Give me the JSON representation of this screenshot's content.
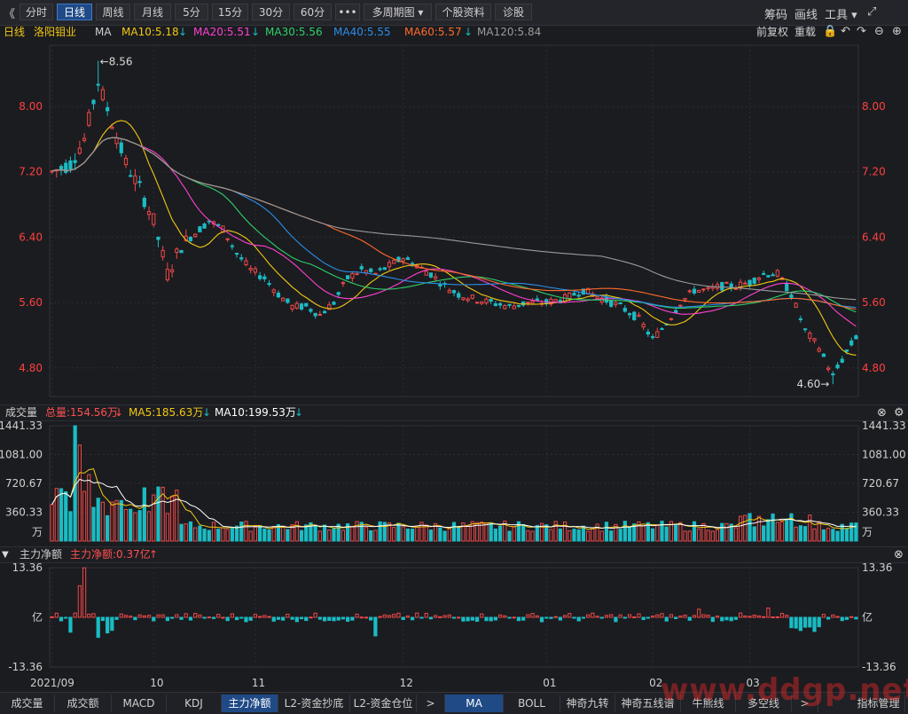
{
  "toolbar": {
    "back": "《",
    "tabs": [
      "分时",
      "日线",
      "周线",
      "月线",
      "5分",
      "15分",
      "30分",
      "60分",
      "•••",
      "多周期图 ▾",
      "个股资料",
      "诊股"
    ],
    "active_tab": 1,
    "right": [
      "筹码",
      "画线",
      "工具 ▾",
      "⤢"
    ]
  },
  "info": {
    "period": "日线",
    "stock": "洛阳钼业",
    "ma_label": "MA",
    "ma10": "MA10:5.18",
    "ma20": "MA20:5.51",
    "ma30": "MA30:5.56",
    "ma40": "MA40:5.55",
    "ma60": "MA60:5.57",
    "ma120": "MA120:5.84",
    "fq": "前复权",
    "reload": "重载"
  },
  "colors": {
    "up": "#f04848",
    "down": "#1bbcc4",
    "grid": "#2c2d33",
    "axis": "#ff4040",
    "ma5": "#ffffff",
    "ma10": "#f2c811",
    "ma20": "#ff40d0",
    "ma30": "#2ed06a",
    "ma40": "#2a8ee8",
    "ma60": "#ff6a2a",
    "ma120": "#9a9a9a"
  },
  "volume_bar": {
    "title": "成交量",
    "total": "总量:154.56万",
    "ma5": "MA5:185.63万",
    "ma10": "MA10:199.53万"
  },
  "flow_bar": {
    "title": "主力净额",
    "value": "主力净额:0.37亿"
  },
  "bottom_tabs": [
    "成交量",
    "成交额",
    "MACD",
    "KDJ",
    "主力净额",
    "L2-资金抄底",
    "L2-资金仓位",
    ">",
    "MA",
    "BOLL",
    "神奇九转",
    "神奇五线谱",
    "牛熊线",
    "多空线",
    ">"
  ],
  "bottom_active": [
    4,
    8
  ],
  "watermark": "www.ddgp.net",
  "chart_data": {
    "type": "candlestick",
    "y_ticks": [
      "8.00",
      "7.20",
      "6.40",
      "5.60",
      "4.80"
    ],
    "y_tick_values": [
      8.0,
      7.2,
      6.4,
      5.6,
      4.8
    ],
    "ylim": [
      4.45,
      8.75
    ],
    "high_marker": "←8.56",
    "high_value": 8.56,
    "low_marker": "4.60→",
    "low_value": 4.6,
    "x_labels": [
      "2021/09",
      "10",
      "11",
      "12",
      "01",
      "02",
      "03"
    ],
    "x_label_index": [
      0,
      22,
      44,
      76,
      107,
      130,
      151
    ],
    "series_count": 175,
    "vol_ticks": [
      "1441.33",
      "1081.00",
      "720.67",
      "360.33",
      "万"
    ],
    "vol_tick_values": [
      1441.33,
      1081.0,
      720.67,
      360.33
    ],
    "vol_max": 1441.33,
    "flow_ticks": [
      "13.36",
      "亿",
      "-13.36"
    ],
    "flow_max": 13.36
  }
}
